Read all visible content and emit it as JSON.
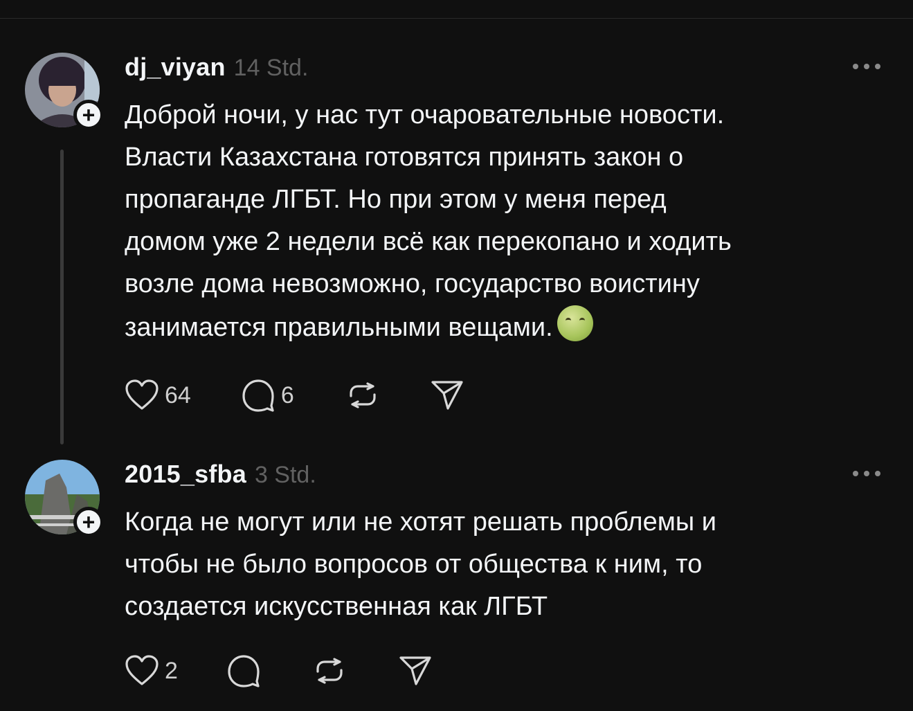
{
  "posts": [
    {
      "username": "dj_viyan",
      "time": "14 Std.",
      "text": "Доброй ночи, у нас тут очаровательные новости.\nВласти Казахстана готовятся принять закон о\nпропаганде ЛГБТ. Но при этом у меня перед\nдомом уже 2 недели всё как перекопано и ходить\nвозле дома невозможно, государство воистину\nзанимается правильными вещами.",
      "emoji": "nauseated-face",
      "likes": "64",
      "replies": "6"
    },
    {
      "username": "2015_sfba",
      "time": "3 Std.",
      "text": "Когда не могут или не хотят решать проблемы и\nчтобы не было вопросов от общества к ним, то\nсоздается искусственная как ЛГБТ",
      "likes": "2",
      "replies": ""
    }
  ],
  "icons": {
    "like": "heart-icon",
    "reply": "comment-icon",
    "repost": "repost-icon",
    "share": "send-icon",
    "more": "more-icon",
    "follow": "plus-icon"
  },
  "colors": {
    "background": "#101010",
    "text": "#f3f5f7",
    "muted": "#616161"
  }
}
